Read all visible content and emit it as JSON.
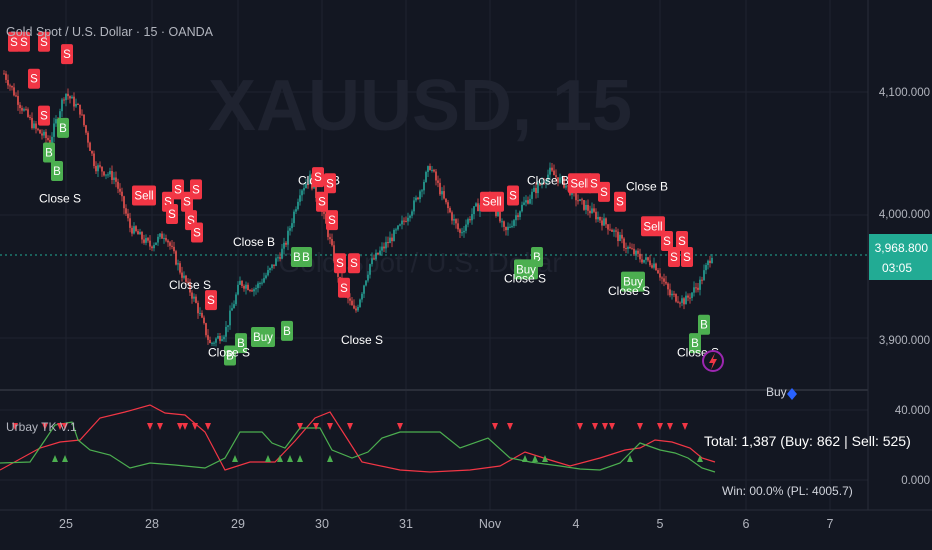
{
  "header": {
    "symbol_title": "Gold Spot / U.S. Dollar · 15 · OANDA",
    "watermark_symbol": "XAUUSD, 15",
    "watermark_name": "Gold Spot / U.S. Dollar"
  },
  "price_scale": {
    "ticks": [
      "4,100.000",
      "4,000.000",
      "3,900.000"
    ],
    "last_price": "3,968.800",
    "countdown": "03:05"
  },
  "indicator": {
    "name": "Urbay TK V.1",
    "ticks": [
      "40.000",
      "0.000"
    ],
    "stats_text": "Total: 1,387 (Buy: 862 | Sell: 525)",
    "stats_text_2": "Win: 00.0% (PL: 4005.7)",
    "legend_text": "Buy"
  },
  "time_axis": {
    "labels": [
      "25",
      "28",
      "29",
      "30",
      "31",
      "Nov",
      "4",
      "5",
      "6",
      "7"
    ]
  },
  "colors": {
    "background": "#131722",
    "grid": "#1f2330",
    "bull": "#26a69a",
    "bear": "#ef5350",
    "buy_label": "#4caf50",
    "sell_label": "#f23645",
    "price_badge": "#22ab94",
    "text": "#b2b5be"
  },
  "icons": {
    "alert": "lightning-alert-icon",
    "legend_marker": "blue-diamond-icon"
  },
  "chart_data": {
    "type": "candlestick",
    "symbol": "XAUUSD",
    "interval": "15",
    "ylim": [
      3870,
      4160
    ],
    "path": [
      [
        4,
        4115
      ],
      [
        20,
        4090
      ],
      [
        35,
        4070
      ],
      [
        50,
        4060
      ],
      [
        65,
        4100
      ],
      [
        80,
        4085
      ],
      [
        95,
        4040
      ],
      [
        115,
        4030
      ],
      [
        130,
        3990
      ],
      [
        150,
        3975
      ],
      [
        165,
        3985
      ],
      [
        180,
        3955
      ],
      [
        195,
        3930
      ],
      [
        210,
        3895
      ],
      [
        225,
        3905
      ],
      [
        240,
        3945
      ],
      [
        255,
        3940
      ],
      [
        270,
        3955
      ],
      [
        285,
        3975
      ],
      [
        300,
        4020
      ],
      [
        310,
        4030
      ],
      [
        325,
        3995
      ],
      [
        340,
        3945
      ],
      [
        355,
        3920
      ],
      [
        370,
        3960
      ],
      [
        385,
        3975
      ],
      [
        400,
        3990
      ],
      [
        415,
        4010
      ],
      [
        430,
        4040
      ],
      [
        445,
        4010
      ],
      [
        460,
        3985
      ],
      [
        475,
        4005
      ],
      [
        490,
        4015
      ],
      [
        505,
        3985
      ],
      [
        520,
        4005
      ],
      [
        535,
        4020
      ],
      [
        550,
        4035
      ],
      [
        565,
        4025
      ],
      [
        580,
        4010
      ],
      [
        595,
        4000
      ],
      [
        610,
        3990
      ],
      [
        625,
        3975
      ],
      [
        640,
        3965
      ],
      [
        655,
        3960
      ],
      [
        670,
        3935
      ],
      [
        685,
        3930
      ],
      [
        700,
        3945
      ],
      [
        712,
        3968.8
      ]
    ],
    "signal_labels": [
      {
        "text": "S",
        "x": 14,
        "price": 4140
      },
      {
        "text": "S",
        "x": 24,
        "price": 4140
      },
      {
        "text": "S",
        "x": 44,
        "price": 4140
      },
      {
        "text": "S",
        "x": 34,
        "price": 4110
      },
      {
        "text": "S",
        "x": 67,
        "price": 4130
      },
      {
        "text": "S",
        "x": 44,
        "price": 4080
      },
      {
        "text": "B",
        "x": 63,
        "price": 4070
      },
      {
        "text": "B",
        "x": 49,
        "price": 4050
      },
      {
        "text": "B",
        "x": 57,
        "price": 4035
      },
      {
        "text": "Close S",
        "x": 60,
        "price": 4010
      },
      {
        "text": "Sell",
        "x": 144,
        "price": 4015
      },
      {
        "text": "S",
        "x": 168,
        "price": 4010
      },
      {
        "text": "S",
        "x": 178,
        "price": 4020
      },
      {
        "text": "S",
        "x": 187,
        "price": 4010
      },
      {
        "text": "S",
        "x": 196,
        "price": 4020
      },
      {
        "text": "S",
        "x": 172,
        "price": 4000
      },
      {
        "text": "S",
        "x": 191,
        "price": 3995
      },
      {
        "text": "S",
        "x": 197,
        "price": 3985
      },
      {
        "text": "Close S",
        "x": 190,
        "price": 3940
      },
      {
        "text": "S",
        "x": 211,
        "price": 3930
      },
      {
        "text": "Close B",
        "x": 254,
        "price": 3975
      },
      {
        "text": "B",
        "x": 297,
        "price": 3965
      },
      {
        "text": "B",
        "x": 306,
        "price": 3965
      },
      {
        "text": "Buy",
        "x": 263,
        "price": 3900
      },
      {
        "text": "B",
        "x": 287,
        "price": 3905
      },
      {
        "text": "B",
        "x": 241,
        "price": 3895
      },
      {
        "text": "B",
        "x": 230,
        "price": 3885
      },
      {
        "text": "Close S",
        "x": 229,
        "price": 3885
      },
      {
        "text": "Close B",
        "x": 319,
        "price": 4025
      },
      {
        "text": "S",
        "x": 318,
        "price": 4030
      },
      {
        "text": "S",
        "x": 330,
        "price": 4025
      },
      {
        "text": "S",
        "x": 322,
        "price": 4010
      },
      {
        "text": "S",
        "x": 332,
        "price": 3995
      },
      {
        "text": "S",
        "x": 340,
        "price": 3960
      },
      {
        "text": "S",
        "x": 354,
        "price": 3960
      },
      {
        "text": "S",
        "x": 344,
        "price": 3940
      },
      {
        "text": "Close S",
        "x": 362,
        "price": 3895
      },
      {
        "text": "Sell",
        "x": 492,
        "price": 4010
      },
      {
        "text": "S",
        "x": 513,
        "price": 4015
      },
      {
        "text": "Close B",
        "x": 548,
        "price": 4025
      },
      {
        "text": "Sell",
        "x": 580,
        "price": 4025
      },
      {
        "text": "S",
        "x": 594,
        "price": 4025
      },
      {
        "text": "S",
        "x": 604,
        "price": 4018
      },
      {
        "text": "S",
        "x": 620,
        "price": 4010
      },
      {
        "text": "Close B",
        "x": 647,
        "price": 4020
      },
      {
        "text": "B",
        "x": 537,
        "price": 3965
      },
      {
        "text": "Buy",
        "x": 526,
        "price": 3955
      },
      {
        "text": "Close S",
        "x": 525,
        "price": 3945
      },
      {
        "text": "Sell",
        "x": 653,
        "price": 3990
      },
      {
        "text": "S",
        "x": 667,
        "price": 3978
      },
      {
        "text": "S",
        "x": 682,
        "price": 3978
      },
      {
        "text": "S",
        "x": 674,
        "price": 3965
      },
      {
        "text": "S",
        "x": 687,
        "price": 3965
      },
      {
        "text": "Buy",
        "x": 633,
        "price": 3945
      },
      {
        "text": "Close S",
        "x": 629,
        "price": 3935
      },
      {
        "text": "B",
        "x": 704,
        "price": 3910
      },
      {
        "text": "B",
        "x": 695,
        "price": 3895
      },
      {
        "text": "Close S",
        "x": 698,
        "price": 3885
      }
    ],
    "indicator_green": [
      [
        0,
        463
      ],
      [
        30,
        462
      ],
      [
        45,
        440
      ],
      [
        55,
        425
      ],
      [
        72,
        422
      ],
      [
        78,
        440
      ],
      [
        90,
        450
      ],
      [
        110,
        455
      ],
      [
        130,
        468
      ],
      [
        150,
        463
      ],
      [
        175,
        465
      ],
      [
        205,
        468
      ],
      [
        225,
        458
      ],
      [
        240,
        432
      ],
      [
        262,
        432
      ],
      [
        272,
        443
      ],
      [
        285,
        448
      ],
      [
        300,
        428
      ],
      [
        320,
        428
      ],
      [
        332,
        450
      ],
      [
        352,
        458
      ],
      [
        368,
        452
      ],
      [
        382,
        438
      ],
      [
        400,
        432
      ],
      [
        420,
        432
      ],
      [
        440,
        432
      ],
      [
        460,
        448
      ],
      [
        488,
        438
      ],
      [
        510,
        458
      ],
      [
        530,
        462
      ],
      [
        560,
        466
      ],
      [
        580,
        469
      ],
      [
        600,
        470
      ],
      [
        620,
        463
      ],
      [
        640,
        443
      ],
      [
        660,
        450
      ],
      [
        675,
        453
      ],
      [
        688,
        458
      ],
      [
        702,
        468
      ],
      [
        715,
        472
      ]
    ],
    "indicator_red": [
      [
        0,
        470
      ],
      [
        40,
        448
      ],
      [
        60,
        442
      ],
      [
        80,
        440
      ],
      [
        100,
        418
      ],
      [
        125,
        412
      ],
      [
        150,
        405
      ],
      [
        165,
        413
      ],
      [
        185,
        415
      ],
      [
        205,
        432
      ],
      [
        225,
        470
      ],
      [
        250,
        462
      ],
      [
        275,
        462
      ],
      [
        295,
        441
      ],
      [
        315,
        418
      ],
      [
        330,
        412
      ],
      [
        348,
        440
      ],
      [
        362,
        462
      ],
      [
        400,
        470
      ],
      [
        430,
        472
      ],
      [
        470,
        470
      ],
      [
        500,
        466
      ],
      [
        525,
        452
      ],
      [
        550,
        460
      ],
      [
        570,
        466
      ],
      [
        600,
        458
      ],
      [
        625,
        450
      ],
      [
        640,
        448
      ],
      [
        655,
        440
      ],
      [
        672,
        442
      ],
      [
        690,
        448
      ],
      [
        702,
        458
      ],
      [
        715,
        462
      ]
    ]
  }
}
